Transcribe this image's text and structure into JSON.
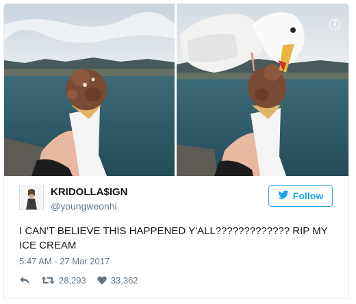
{
  "tweet": {
    "display_name": "KRIDOLLA$IGN",
    "handle": "@youngweonhi",
    "text": "I CAN'T BELIEVE THIS HAPPENED Y'ALL????????????? RIP MY ICE CREAM",
    "timestamp": "5:47 AM - 27 Mar 2017",
    "retweets": "28,293",
    "likes": "33,362"
  },
  "follow_button": {
    "label": "Follow",
    "icon": "twitter-bird-icon"
  },
  "media": {
    "info_icon": "i",
    "photos": [
      "ice-cream-cone-photo",
      "seagull-biting-ice-cream-photo"
    ]
  },
  "colors": {
    "accent": "#1da1f2",
    "text": "#14171a",
    "muted": "#657786",
    "border": "#e1e8ed"
  }
}
